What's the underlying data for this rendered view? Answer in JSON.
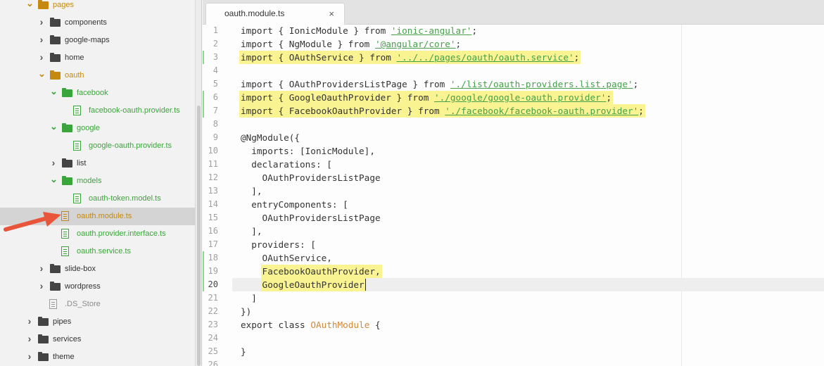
{
  "sidebar": {
    "tree": [
      {
        "label": "pages",
        "kind": "folder",
        "expanded": true,
        "depth": 0,
        "color": "#c4890e",
        "labelColor": "#c4890e"
      },
      {
        "label": "components",
        "kind": "folder",
        "expanded": false,
        "depth": 1,
        "color": "#444444",
        "labelColor": "#333333"
      },
      {
        "label": "google-maps",
        "kind": "folder",
        "expanded": false,
        "depth": 1,
        "color": "#444444",
        "labelColor": "#333333"
      },
      {
        "label": "home",
        "kind": "folder",
        "expanded": false,
        "depth": 1,
        "color": "#444444",
        "labelColor": "#333333"
      },
      {
        "label": "oauth",
        "kind": "folder",
        "expanded": true,
        "depth": 1,
        "color": "#c4890e",
        "labelColor": "#c4890e"
      },
      {
        "label": "facebook",
        "kind": "folder",
        "expanded": true,
        "depth": 2,
        "color": "#3aa53a",
        "labelColor": "#3aa53a"
      },
      {
        "label": "facebook-oauth.provider.ts",
        "kind": "file",
        "depth": 3,
        "color": "#3aa53a",
        "labelColor": "#3aa53a"
      },
      {
        "label": "google",
        "kind": "folder",
        "expanded": true,
        "depth": 2,
        "color": "#3aa53a",
        "labelColor": "#3aa53a"
      },
      {
        "label": "google-oauth.provider.ts",
        "kind": "file",
        "depth": 3,
        "color": "#3aa53a",
        "labelColor": "#3aa53a"
      },
      {
        "label": "list",
        "kind": "folder",
        "expanded": false,
        "depth": 2,
        "color": "#444444",
        "labelColor": "#333333"
      },
      {
        "label": "models",
        "kind": "folder",
        "expanded": true,
        "depth": 2,
        "color": "#3aa53a",
        "labelColor": "#3aa53a"
      },
      {
        "label": "oauth-token.model.ts",
        "kind": "file",
        "depth": 3,
        "color": "#3aa53a",
        "labelColor": "#3aa53a"
      },
      {
        "label": "oauth.module.ts",
        "kind": "file",
        "depth": 2,
        "color": "#c4890e",
        "labelColor": "#c4890e",
        "selected": true
      },
      {
        "label": "oauth.provider.interface.ts",
        "kind": "file",
        "depth": 2,
        "color": "#3aa53a",
        "labelColor": "#3aa53a"
      },
      {
        "label": "oauth.service.ts",
        "kind": "file",
        "depth": 2,
        "color": "#3aa53a",
        "labelColor": "#3aa53a"
      },
      {
        "label": "slide-box",
        "kind": "folder",
        "expanded": false,
        "depth": 1,
        "color": "#444444",
        "labelColor": "#333333"
      },
      {
        "label": "wordpress",
        "kind": "folder",
        "expanded": false,
        "depth": 1,
        "color": "#444444",
        "labelColor": "#333333"
      },
      {
        "label": ".DS_Store",
        "kind": "file",
        "depth": 1,
        "color": "#9a9a9a",
        "labelColor": "#8a8a8a"
      },
      {
        "label": "pipes",
        "kind": "folder",
        "expanded": false,
        "depth": 0,
        "color": "#444444",
        "labelColor": "#333333"
      },
      {
        "label": "services",
        "kind": "folder",
        "expanded": false,
        "depth": 0,
        "color": "#444444",
        "labelColor": "#333333"
      },
      {
        "label": "theme",
        "kind": "folder",
        "expanded": false,
        "depth": 0,
        "color": "#444444",
        "labelColor": "#333333"
      }
    ]
  },
  "tab": {
    "title": "oauth.module.ts",
    "close": "×"
  },
  "editor": {
    "current_line": 20,
    "lines": [
      {
        "n": "1",
        "tokens": [
          [
            "kw",
            "import { IonicModule } from "
          ],
          [
            "str",
            "'ionic-angular'"
          ],
          [
            "kw",
            ";"
          ]
        ]
      },
      {
        "n": "2",
        "tokens": [
          [
            "kw",
            "import { NgModule } from "
          ],
          [
            "str",
            "'@angular/core'"
          ],
          [
            "kw",
            ";"
          ]
        ]
      },
      {
        "n": "3",
        "changed": true,
        "highlight": true,
        "tokens": [
          [
            "kw",
            "import { OAuthService } from "
          ],
          [
            "str",
            "'../../pages/oauth/oauth.service'"
          ],
          [
            "kw",
            ";"
          ]
        ]
      },
      {
        "n": "4",
        "tokens": []
      },
      {
        "n": "5",
        "tokens": [
          [
            "kw",
            "import { OAuthProvidersListPage } from "
          ],
          [
            "str",
            "'./list/oauth-providers.list.page'"
          ],
          [
            "kw",
            ";"
          ]
        ]
      },
      {
        "n": "6",
        "changed": true,
        "highlight": true,
        "tokens": [
          [
            "kw",
            "import { GoogleOauthProvider } from "
          ],
          [
            "str",
            "'./google/google-oauth.provider'"
          ],
          [
            "kw",
            ";"
          ]
        ]
      },
      {
        "n": "7",
        "changed": true,
        "highlight": true,
        "tokens": [
          [
            "kw",
            "import { FacebookOauthProvider } from "
          ],
          [
            "str",
            "'./facebook/facebook-oauth.provider'"
          ],
          [
            "kw",
            ";"
          ]
        ]
      },
      {
        "n": "8",
        "tokens": []
      },
      {
        "n": "9",
        "tokens": [
          [
            "kw",
            "@NgModule({"
          ]
        ]
      },
      {
        "n": "10",
        "tokens": [
          [
            "kw",
            "  imports: [IonicModule],"
          ]
        ]
      },
      {
        "n": "11",
        "tokens": [
          [
            "kw",
            "  declarations: ["
          ]
        ]
      },
      {
        "n": "12",
        "tokens": [
          [
            "kw",
            "    OAuthProvidersListPage"
          ]
        ]
      },
      {
        "n": "13",
        "tokens": [
          [
            "kw",
            "  ],"
          ]
        ]
      },
      {
        "n": "14",
        "tokens": [
          [
            "kw",
            "  entryComponents: ["
          ]
        ]
      },
      {
        "n": "15",
        "tokens": [
          [
            "kw",
            "    OAuthProvidersListPage"
          ]
        ]
      },
      {
        "n": "16",
        "tokens": [
          [
            "kw",
            "  ],"
          ]
        ]
      },
      {
        "n": "17",
        "tokens": [
          [
            "kw",
            "  providers: ["
          ]
        ]
      },
      {
        "n": "18",
        "changed": true,
        "tokens": [
          [
            "kw",
            "    OAuthService,"
          ]
        ]
      },
      {
        "n": "19",
        "changed": true,
        "highlight": true,
        "hlFrom": 4,
        "tokens": [
          [
            "kw",
            "    FacebookOauthProvider,"
          ]
        ]
      },
      {
        "n": "20",
        "changed": true,
        "highlight": true,
        "hlFrom": 4,
        "cursor": true,
        "tokens": [
          [
            "kw",
            "    GoogleOauthProvider"
          ]
        ]
      },
      {
        "n": "21",
        "tokens": [
          [
            "kw",
            "  ]"
          ]
        ]
      },
      {
        "n": "22",
        "tokens": [
          [
            "kw",
            "})"
          ]
        ]
      },
      {
        "n": "23",
        "tokens": [
          [
            "kw",
            "export class "
          ],
          [
            "cls",
            "OAuthModule"
          ],
          [
            "kw",
            " {"
          ]
        ]
      },
      {
        "n": "24",
        "tokens": []
      },
      {
        "n": "25",
        "tokens": [
          [
            "kw",
            "}"
          ]
        ]
      },
      {
        "n": "26",
        "tokens": []
      }
    ]
  },
  "colors": {
    "highlight": "#f9f392",
    "string": "#46a04a",
    "class": "#d08a3b",
    "arrow": "#e8553b",
    "selected_row": "#d4d4d4"
  }
}
